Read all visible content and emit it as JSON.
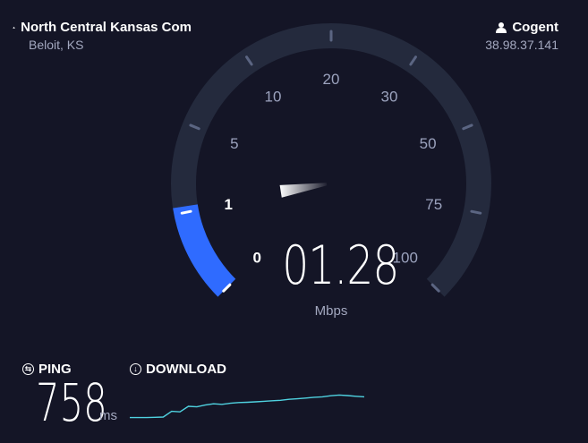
{
  "isp": {
    "name": "North Central Kansas Com",
    "location": "Beloit, KS",
    "icon": "isp-triangle-icon"
  },
  "server": {
    "name": "Cogent",
    "ip": "38.98.37.141",
    "icon": "user-icon"
  },
  "gauge": {
    "scale_labels": [
      "0",
      "1",
      "5",
      "10",
      "20",
      "30",
      "50",
      "75",
      "100"
    ],
    "current_value": 1.28,
    "max": 100
  },
  "speed": {
    "value": "01.28",
    "unit": "Mbps"
  },
  "ping": {
    "label": "PING",
    "value": "758",
    "unit": "ms",
    "icon": "ping-icon"
  },
  "download": {
    "label": "DOWNLOAD",
    "icon": "download-arrow-icon",
    "history": [
      0.05,
      0.05,
      0.05,
      0.06,
      0.07,
      0.3,
      0.28,
      0.5,
      0.48,
      0.55,
      0.6,
      0.58,
      0.62,
      0.65,
      0.66,
      0.68,
      0.7,
      0.72,
      0.74,
      0.78,
      0.8,
      0.83,
      0.86,
      0.88,
      0.92,
      0.95,
      0.93,
      0.9,
      0.88
    ]
  },
  "colors": {
    "background": "#141526",
    "arc_track": "#242a3d",
    "arc_fill": "#2f6bff",
    "label_color": "#9ba2bd",
    "sparkline": "#4fd2e0"
  }
}
